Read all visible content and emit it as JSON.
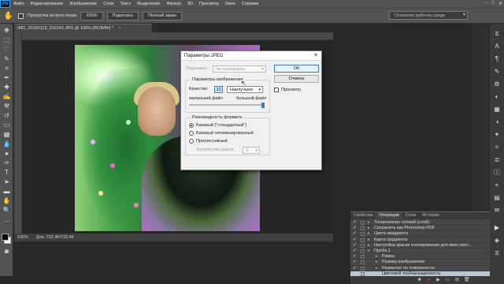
{
  "menubar": {
    "logo": "Ps",
    "items": [
      "Файл",
      "Редактирование",
      "Изображение",
      "Слои",
      "Текст",
      "Выделение",
      "Фильтр",
      "3D",
      "Просмотр",
      "Окно",
      "Справка"
    ],
    "controls": [
      "–",
      "□",
      "✕"
    ]
  },
  "options": {
    "scroll_all_label": "Прокрутка во всех окнах",
    "zoom_100": "100%",
    "fit_label": "Подогнать",
    "fullscreen_label": "Полный экран",
    "workspace": "Основная рабочая среда"
  },
  "document": {
    "tab_title": "IMG_20160119_015142.JPG @ 100% (RGB/8#) *",
    "tab_close": "×",
    "status_zoom": "100%",
    "status_doc": "Док: 732,4К/732,4К"
  },
  "dialog": {
    "title": "Параметры JPEG",
    "close": "✕",
    "matte_label": "Подложка:",
    "matte_value": "Не показывать",
    "ok_label": "ОК",
    "cancel_label": "Отмена",
    "preview_label": "Просмотр",
    "image_options_title": "Параметры изображения",
    "quality_label": "Качество:",
    "quality_value": "12",
    "quality_preset": "Наилучшее",
    "small_file": "маленький файл",
    "large_file": "большой файл",
    "quality_level": 1.0,
    "format_options_title": "Разновидность формата",
    "format_options": [
      "Базовый (\"стандартный\")",
      "Базовый оптимизированный",
      "Прогрессивный"
    ],
    "format_selected": 0,
    "scans_label": "Количество шагов:",
    "scans_value": "3"
  },
  "panel": {
    "tabs": [
      "Свойства",
      "Операции",
      "Слои",
      "История"
    ],
    "active_tab": 1,
    "actions": [
      {
        "label": "Тонирование сепией (слой)",
        "level": 1
      },
      {
        "label": "Сохранить как Photoshop PDF",
        "level": 1
      },
      {
        "label": "Цвета квадранта",
        "level": 1
      },
      {
        "label": "Карта градиента",
        "level": 1
      },
      {
        "label": "Настройка краски клонирования для микс-кист...",
        "level": 1
      },
      {
        "label": "Проба 1",
        "level": 1,
        "expanded": true
      },
      {
        "label": "Рамка",
        "level": 2
      },
      {
        "label": "Размер изображения",
        "level": 2
      },
      {
        "label": "Размытие по поверхности",
        "level": 2
      },
      {
        "label": "Цветовой тон/Насыщенность",
        "level": 2,
        "selected": true
      }
    ]
  },
  "icons": {
    "tool_hand": "hand-icon",
    "colors": {
      "foreground": "#000000",
      "background": "#ffffff"
    }
  }
}
